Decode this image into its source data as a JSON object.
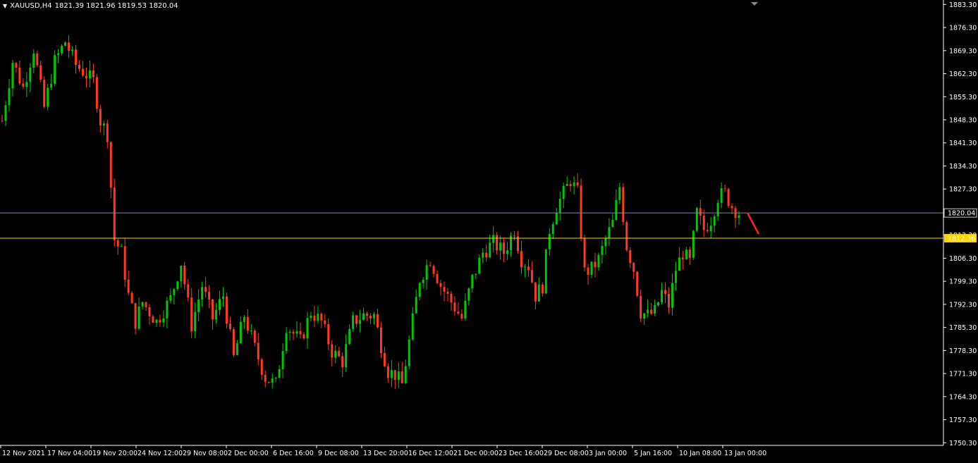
{
  "header": {
    "symbol_timeframe": "XAUUSD,H4",
    "ohlc": "1821.39 1821.96 1819.53 1820.04"
  },
  "colors": {
    "background": "#000000",
    "bull": "#00c800",
    "bear": "#ff3a1e",
    "axis": "#ffffff",
    "bid_line": "#7a8aa0",
    "level_line": "#ffd400",
    "level_tag": "#ffd400",
    "arrow": "#ff2020"
  },
  "price_axis": {
    "labels": [
      "1883.30",
      "1876.30",
      "1869.30",
      "1862.30",
      "1855.30",
      "1848.30",
      "1841.30",
      "1834.30",
      "1827.30",
      "1820.30",
      "1813.30",
      "1806.30",
      "1799.30",
      "1792.30",
      "1785.30",
      "1778.30",
      "1771.30",
      "1764.30",
      "1757.30",
      "1750.30"
    ],
    "current_price_tag": "1820.04",
    "level_tag": "1812.36"
  },
  "time_axis": {
    "labels": [
      "12 Nov 2021",
      "17 Nov 04:00",
      "19 Nov 20:00",
      "24 Nov 12:00",
      "29 Nov 08:00",
      "2 Dec 00:00",
      "6 Dec 16:00",
      "9 Dec 08:00",
      "13 Dec 20:00",
      "16 Dec 12:00",
      "21 Dec 00:00",
      "23 Dec 16:00",
      "29 Dec 08:00",
      "3 Jan 00:00",
      "5 Jan 16:00",
      "10 Jan 08:00",
      "13 Jan 00:00"
    ]
  },
  "chart_data": {
    "type": "candlestick",
    "symbol": "XAUUSD",
    "timeframe": "H4",
    "ylim": [
      1749.5,
      1883.8
    ],
    "horizontal_lines": [
      {
        "price": 1820.04,
        "label": "1820.04"
      },
      {
        "price": 1812.36,
        "label": "1812.36"
      }
    ],
    "waypoints": [
      [
        0,
        1848
      ],
      [
        3,
        1866
      ],
      [
        6,
        1858
      ],
      [
        9,
        1870
      ],
      [
        12,
        1852
      ],
      [
        15,
        1866
      ],
      [
        18,
        1872
      ],
      [
        21,
        1865
      ],
      [
        24,
        1862
      ],
      [
        26,
        1860
      ],
      [
        28,
        1848
      ],
      [
        30,
        1844
      ],
      [
        32,
        1812
      ],
      [
        34,
        1808
      ],
      [
        36,
        1795
      ],
      [
        38,
        1787
      ],
      [
        40,
        1793
      ],
      [
        44,
        1787
      ],
      [
        48,
        1794
      ],
      [
        51,
        1805
      ],
      [
        54,
        1786
      ],
      [
        57,
        1798
      ],
      [
        60,
        1788
      ],
      [
        63,
        1795
      ],
      [
        66,
        1776
      ],
      [
        69,
        1789
      ],
      [
        72,
        1779
      ],
      [
        75,
        1770
      ],
      [
        78,
        1768
      ],
      [
        81,
        1786
      ],
      [
        85,
        1781
      ],
      [
        88,
        1790
      ],
      [
        91,
        1787
      ],
      [
        94,
        1778
      ],
      [
        97,
        1775
      ],
      [
        100,
        1787
      ],
      [
        103,
        1789
      ],
      [
        106,
        1789
      ],
      [
        108,
        1780
      ],
      [
        110,
        1772
      ],
      [
        112,
        1771
      ],
      [
        114,
        1768
      ],
      [
        116,
        1781
      ],
      [
        119,
        1800
      ],
      [
        122,
        1806
      ],
      [
        125,
        1798
      ],
      [
        128,
        1793
      ],
      [
        131,
        1788
      ],
      [
        134,
        1800
      ],
      [
        137,
        1808
      ],
      [
        140,
        1811
      ],
      [
        143,
        1808
      ],
      [
        146,
        1815
      ],
      [
        148,
        1806
      ],
      [
        150,
        1804
      ],
      [
        152,
        1795
      ],
      [
        154,
        1798
      ],
      [
        156,
        1815
      ],
      [
        158,
        1822
      ],
      [
        160,
        1826
      ],
      [
        162,
        1830
      ],
      [
        164,
        1826
      ],
      [
        166,
        1802
      ],
      [
        168,
        1803
      ],
      [
        170,
        1806
      ],
      [
        172,
        1812
      ],
      [
        174,
        1817
      ],
      [
        176,
        1828
      ],
      [
        178,
        1810
      ],
      [
        180,
        1803
      ],
      [
        182,
        1790
      ],
      [
        184,
        1789
      ],
      [
        186,
        1790
      ],
      [
        188,
        1796
      ],
      [
        190,
        1792
      ],
      [
        192,
        1803
      ],
      [
        194,
        1808
      ],
      [
        196,
        1805
      ],
      [
        198,
        1820
      ],
      [
        200,
        1815
      ],
      [
        202,
        1818
      ],
      [
        204,
        1825
      ],
      [
        206,
        1826
      ],
      [
        208,
        1822
      ],
      [
        210,
        1820
      ]
    ],
    "note_arrow": "downward red arrow drawn after last candle"
  }
}
